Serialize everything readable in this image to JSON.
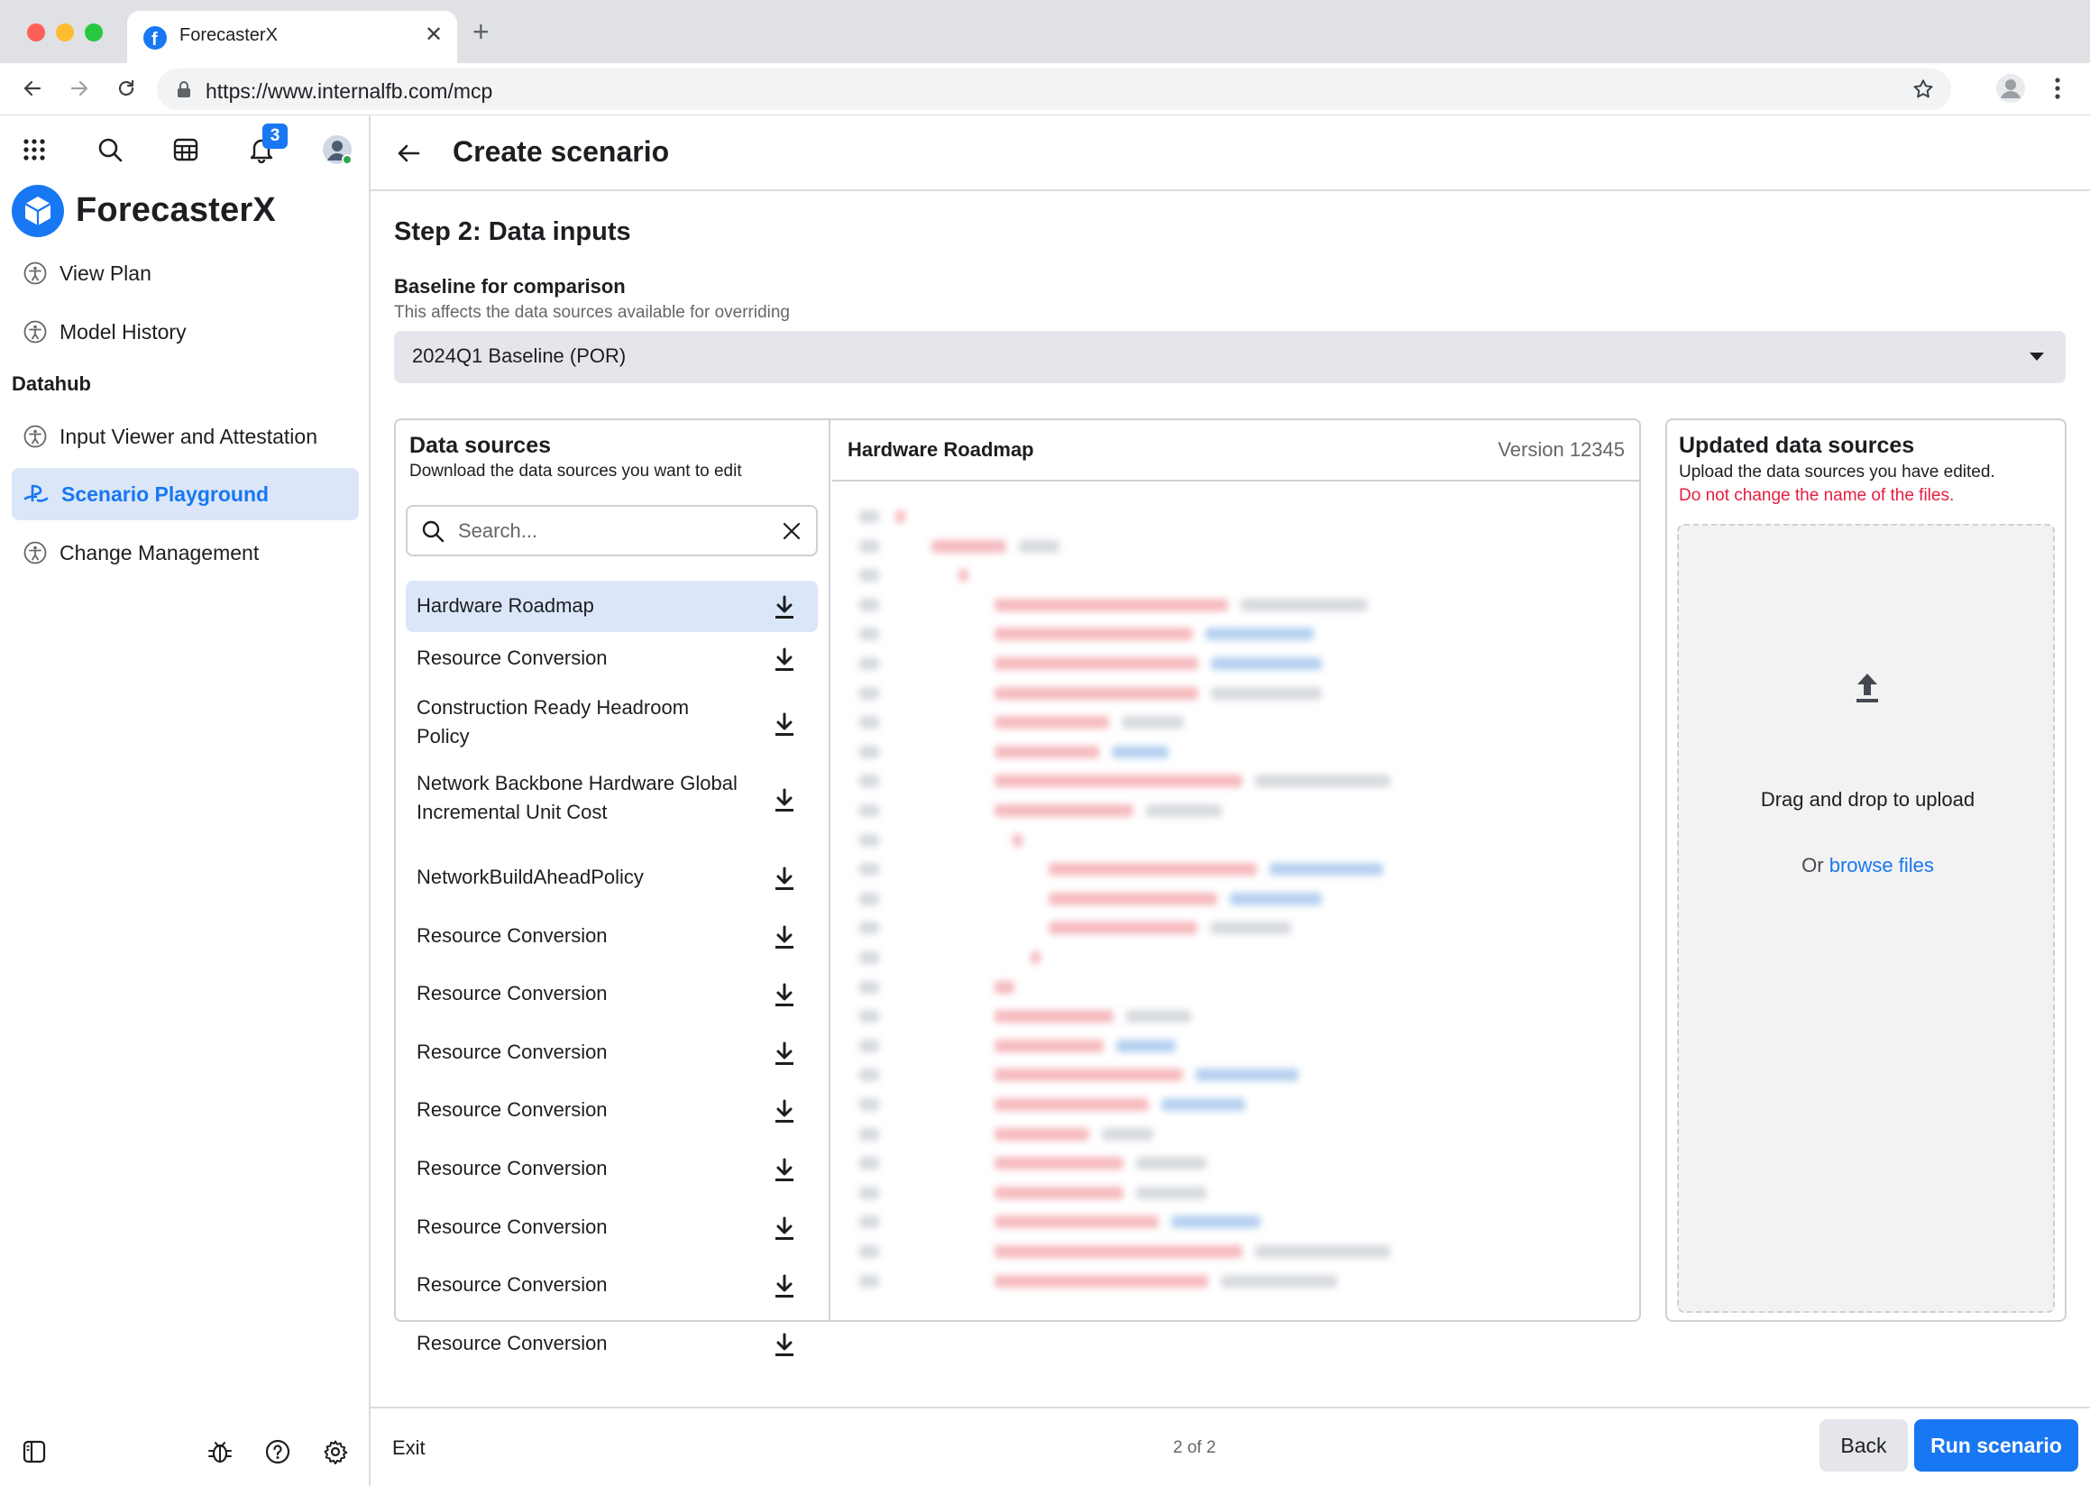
{
  "browser": {
    "tab_title": "ForecasterX",
    "url": "https://www.internalfb.com/mcp"
  },
  "sidebar": {
    "notification_count": "3",
    "app_name": "ForecasterX",
    "nav_primary": [
      {
        "label": "View Plan",
        "icon": "accessibility-icon"
      },
      {
        "label": "Model History",
        "icon": "accessibility-icon"
      }
    ],
    "section_title": "Datahub",
    "nav_datahub": [
      {
        "label": "Input Viewer and Attestation",
        "icon": "accessibility-icon",
        "active": false
      },
      {
        "label": "Scenario Playground",
        "icon": "gamepad-icon",
        "active": true
      },
      {
        "label": "Change Management",
        "icon": "accessibility-icon",
        "active": false
      }
    ]
  },
  "header": {
    "title": "Create scenario"
  },
  "step": {
    "title": "Step 2: Data inputs",
    "baseline_label": "Baseline for comparison",
    "baseline_help": "This affects the data sources available for overriding",
    "baseline_value": "2024Q1 Baseline (POR)"
  },
  "data_sources": {
    "title": "Data sources",
    "subtitle": "Download the data sources you want to edit",
    "search_placeholder": "Search...",
    "items": [
      {
        "label": "Hardware Roadmap",
        "selected": true
      },
      {
        "label": "Resource Conversion",
        "selected": false
      },
      {
        "label": "Construction Ready Headroom Policy",
        "selected": false
      },
      {
        "label": "Network Backbone Hardware Global Incremental Unit Cost",
        "selected": false
      },
      {
        "label": "NetworkBuildAheadPolicy",
        "selected": false
      },
      {
        "label": "Resource Conversion",
        "selected": false
      },
      {
        "label": "Resource Conversion",
        "selected": false
      },
      {
        "label": "Resource Conversion",
        "selected": false
      },
      {
        "label": "Resource Conversion",
        "selected": false
      },
      {
        "label": "Resource Conversion",
        "selected": false
      },
      {
        "label": "Resource Conversion",
        "selected": false
      },
      {
        "label": "Resource Conversion",
        "selected": false
      },
      {
        "label": "Resource Conversion",
        "selected": false
      }
    ]
  },
  "preview": {
    "title": "Hardware Roadmap",
    "version": "Version 12345"
  },
  "upload": {
    "title": "Updated data sources",
    "subtitle": "Upload the data sources you have edited.",
    "warning": "Do not change the name of the files.",
    "drop_text": "Drag and drop to upload",
    "browse_prefix": "Or",
    "browse_link": "browse files"
  },
  "footer": {
    "exit_label": "Exit",
    "pager": "2 of 2",
    "back_label": "Back",
    "run_label": "Run scenario"
  },
  "colors": {
    "accent": "#1877f2",
    "selected_bg": "#dbe7f9",
    "warning": "#e41e3f"
  }
}
